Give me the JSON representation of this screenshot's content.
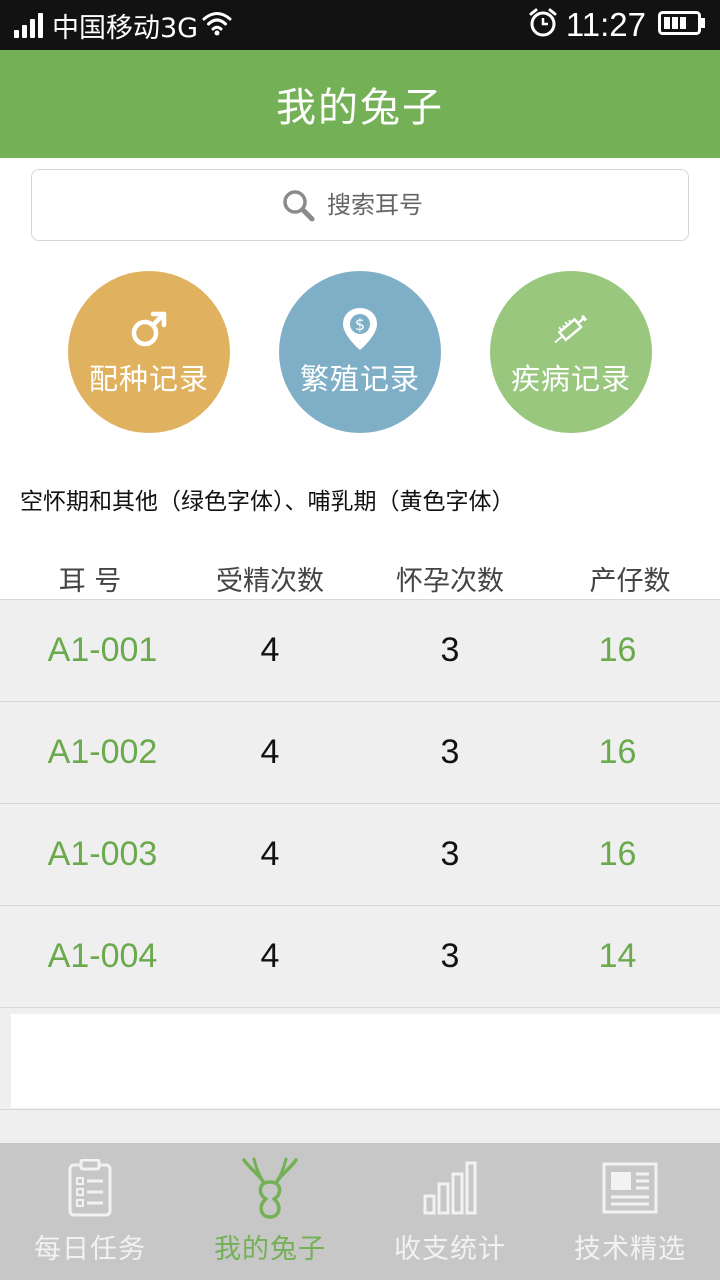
{
  "status_bar": {
    "carrier": "中国移动3G",
    "time": "11:27"
  },
  "header": {
    "title": "我的兔子"
  },
  "search": {
    "placeholder": "搜索耳号"
  },
  "actions": [
    {
      "label": "配种记录",
      "icon": "male-symbol-icon",
      "color": "#e0b25f"
    },
    {
      "label": "繁殖记录",
      "icon": "location-dollar-icon",
      "color": "#7fafc7"
    },
    {
      "label": "疾病记录",
      "icon": "syringe-icon",
      "color": "#98c77d"
    }
  ],
  "legend_note": "空怀期和其他（绿色字体）、哺乳期（黄色字体）",
  "table": {
    "headers": [
      "耳 号",
      "受精次数",
      "怀孕次数",
      "产仔数"
    ],
    "rows": [
      {
        "id": "A1-001",
        "fertilized": "4",
        "pregnant": "3",
        "litter": "16"
      },
      {
        "id": "A1-002",
        "fertilized": "4",
        "pregnant": "3",
        "litter": "16"
      },
      {
        "id": "A1-003",
        "fertilized": "4",
        "pregnant": "3",
        "litter": "16"
      },
      {
        "id": "A1-004",
        "fertilized": "4",
        "pregnant": "3",
        "litter": "14"
      }
    ]
  },
  "tabs": [
    {
      "label": "每日任务",
      "icon": "clipboard-checklist-icon",
      "active": false
    },
    {
      "label": "我的兔子",
      "icon": "rabbit-icon",
      "active": true
    },
    {
      "label": "收支统计",
      "icon": "bar-chart-icon",
      "active": false
    },
    {
      "label": "技术精选",
      "icon": "newspaper-icon",
      "active": false
    }
  ],
  "colors": {
    "brand_green": "#74b056",
    "status_green_text": "#6aaa4c",
    "tab_bar": "#c7c7c7"
  }
}
